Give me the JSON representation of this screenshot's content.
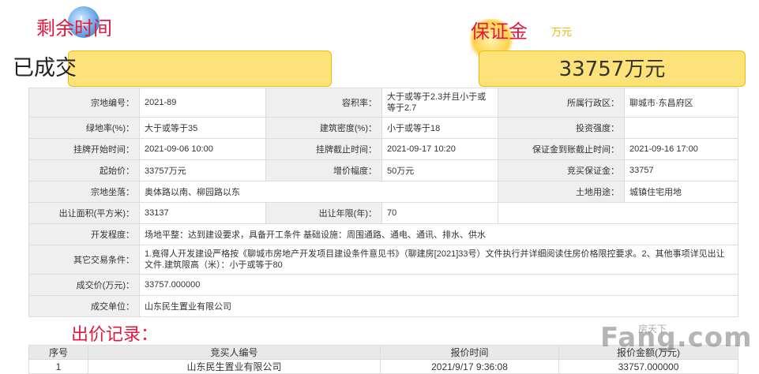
{
  "header": {
    "remaining_time_label": "剩余时间",
    "deposit_label": "保证金",
    "unit_label": "万元",
    "status_text": "已成交",
    "amount_text": "33757万元"
  },
  "info": {
    "rows": [
      [
        "宗地编号：",
        "2021-89",
        "容积率：",
        "大于或等于2.3并且小于或等于2.7",
        "所属行政区：",
        "聊城市·东昌府区"
      ],
      [
        "绿地率(%)：",
        "大于或等于35",
        "建筑密度(%)：",
        "小于或等于18",
        "投资强度：",
        ""
      ],
      [
        "挂牌开始时间：",
        "2021-09-06 10:00",
        "挂牌截止时间：",
        "2021-09-17 10:20",
        "保证金到账截止时间：",
        "2021-09-16 17:00"
      ],
      [
        "起始价：",
        "33757万元",
        "增价幅度：",
        "50万元",
        "竞买保证金：",
        "33757"
      ]
    ],
    "location_label": "宗地坐落：",
    "location_value": "奥体路以南、柳园路以东",
    "land_use_label": "土地用途：",
    "land_use_value": "城镇住宅用地",
    "area_label": "出让面积(平方米)：",
    "area_value": "33137",
    "term_label": "出让年限(年)：",
    "term_value": "70",
    "dev_label": "开发程度：",
    "dev_value": "场地平整：达到建设要求，具备开工条件 基础设施：周围通路、通电、通讯、排水、供水",
    "other_label": "其它交易条件：",
    "other_value": "1.竟得人开发建设严格按《聊城市房地产开发项目建设条件意见书》（聊建房[2021]33号）文件执行并详细阅读住房价格限控要求。2、其他事项详见出让文件.建筑限高（米）：小于或等于80",
    "deal_price_label": "成交价(万元)：",
    "deal_price_value": "33757.000000",
    "deal_unit_label": "成交单位：",
    "deal_unit_value": "山东民生置业有限公司"
  },
  "bids": {
    "title": "出价记录：",
    "headers": [
      "序号",
      "竞买人编号",
      "报价时间",
      "报价金额(万元)"
    ],
    "rows": [
      [
        "1",
        "山东民生置业有限公司",
        "2021/9/17 9:36:08",
        "33757.000000"
      ]
    ]
  },
  "watermark": {
    "text": "Fang.com",
    "sub": "房天下"
  },
  "colors": {
    "title_red": "#e4183d",
    "highlight_yellow": "#fde27a"
  }
}
